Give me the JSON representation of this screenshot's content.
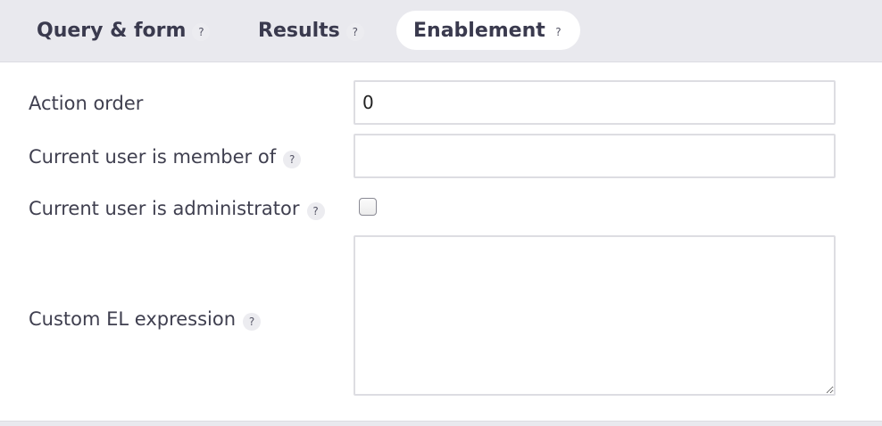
{
  "tabs": [
    {
      "label": "Query & form",
      "help": "?",
      "active": false
    },
    {
      "label": "Results",
      "help": "?",
      "active": false
    },
    {
      "label": "Enablement",
      "help": "?",
      "active": true
    }
  ],
  "form": {
    "action_order": {
      "label": "Action order",
      "value": "0"
    },
    "member_of": {
      "label": "Current user is member of",
      "help": "?",
      "value": ""
    },
    "is_admin": {
      "label": "Current user is administrator",
      "help": "?",
      "checked": false
    },
    "el_expression": {
      "label": "Custom EL expression",
      "help": "?",
      "value": ""
    }
  }
}
